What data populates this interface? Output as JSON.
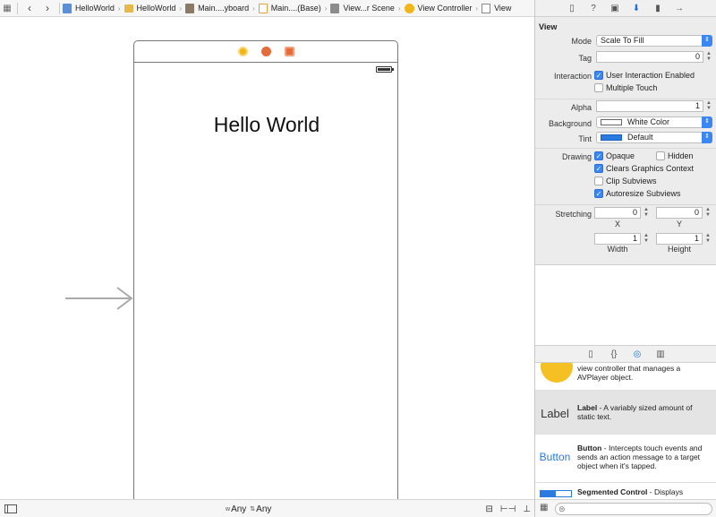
{
  "jumpbar": {
    "crumbs": [
      "HelloWorld",
      "HelloWorld",
      "Main....yboard",
      "Main....(Base)",
      "View...r Scene",
      "View Controller",
      "View"
    ]
  },
  "canvas": {
    "hello_text": "Hello World"
  },
  "bottombar": {
    "w_prefix": "w",
    "w_value": "Any",
    "h_prefix": "h",
    "h_value": "Any"
  },
  "inspector": {
    "section_title": "View",
    "mode_label": "Mode",
    "mode_value": "Scale To Fill",
    "tag_label": "Tag",
    "tag_value": "0",
    "interaction_label": "Interaction",
    "user_interaction": "User Interaction Enabled",
    "multiple_touch": "Multiple Touch",
    "alpha_label": "Alpha",
    "alpha_value": "1",
    "background_label": "Background",
    "background_value": "White Color",
    "tint_label": "Tint",
    "tint_value": "Default",
    "drawing_label": "Drawing",
    "opaque": "Opaque",
    "hidden": "Hidden",
    "clears_graphics": "Clears Graphics Context",
    "clip_subviews": "Clip Subviews",
    "autoresize_subviews": "Autoresize Subviews",
    "stretching_label": "Stretching",
    "stretch_x": "0",
    "stretch_y": "0",
    "stretch_w": "1",
    "stretch_h": "1",
    "x_label": "X",
    "y_label": "Y",
    "width_label": "Width",
    "height_label": "Height"
  },
  "library": {
    "avplayer_desc": "view controller that manages a AVPlayer object.",
    "label_thumb": "Label",
    "label_name": "Label",
    "label_desc": " - A variably sized amount of static text.",
    "button_thumb": "Button",
    "button_name": "Button",
    "button_desc": " - Intercepts touch events and sends an action message to a target object when it's tapped.",
    "segmented_name": "Segmented Control",
    "segmented_desc": " - Displays"
  },
  "colors": {
    "accent": "#3a86f2",
    "vc_icon": "#f2b619",
    "exit_icon": "#e46b3a"
  }
}
